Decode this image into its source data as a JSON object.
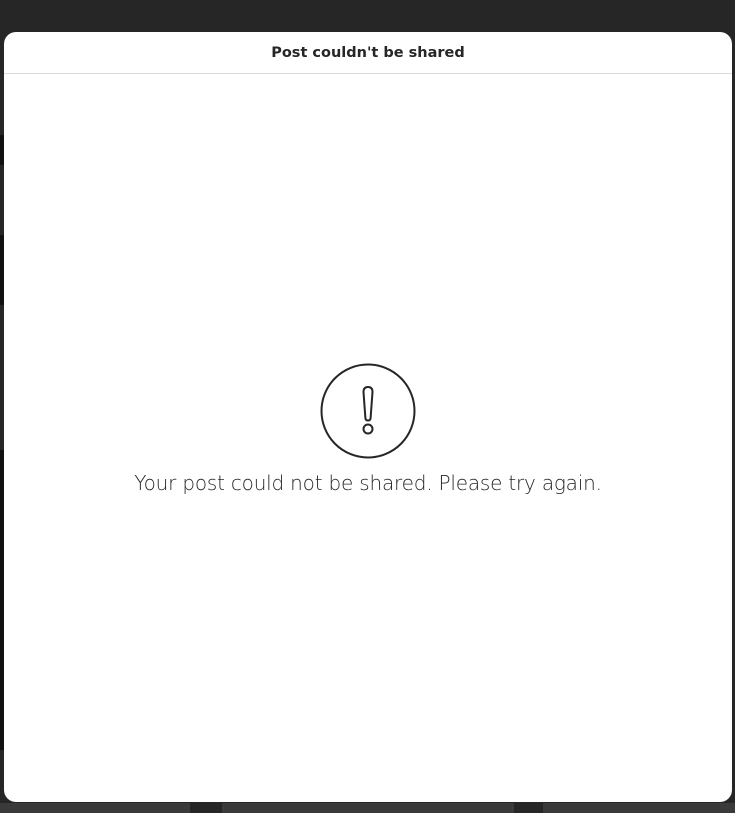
{
  "modal": {
    "title": "Post couldn't be shared",
    "icon": "exclamation-circle-icon",
    "message": "Your post could not be shared. Please try again."
  },
  "colors": {
    "backdrop": "#262626",
    "modal_bg": "#ffffff",
    "text": "#262626",
    "divider": "#dbdbdb"
  }
}
